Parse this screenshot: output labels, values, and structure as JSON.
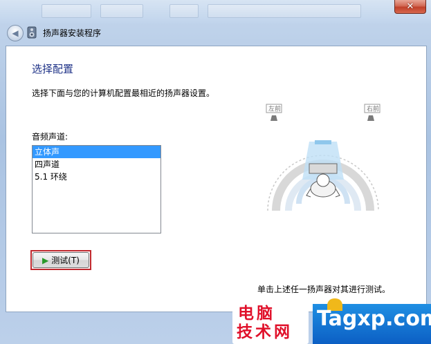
{
  "window": {
    "title": "扬声器安装程序",
    "close_glyph": "✕"
  },
  "page": {
    "heading": "选择配置",
    "description": "选择下面与您的计算机配置最相近的扬声器设置。",
    "channels_label": "音频声道:",
    "channels": [
      {
        "label": "立体声",
        "selected": true
      },
      {
        "label": "四声道",
        "selected": false
      },
      {
        "label": "5.1 环绕",
        "selected": false
      }
    ],
    "test_button_label": "测试(T)",
    "speaker_left_label": "左前",
    "speaker_right_label": "右前",
    "hint": "单击上述任一扬声器对其进行测试。"
  },
  "watermark": {
    "line1": "电脑",
    "line2": "技术网",
    "site": "Tagxp.com"
  },
  "colors": {
    "heading": "#1e3287",
    "selection": "#3399ff",
    "highlight_border": "#c0282d",
    "watermark_red": "#e0102a",
    "watermark_blue": "#0c5fc4"
  },
  "icons": {
    "back": "back-arrow-icon",
    "wizard": "speaker-setup-icon",
    "play": "play-icon",
    "speaker": "speaker-icon"
  }
}
